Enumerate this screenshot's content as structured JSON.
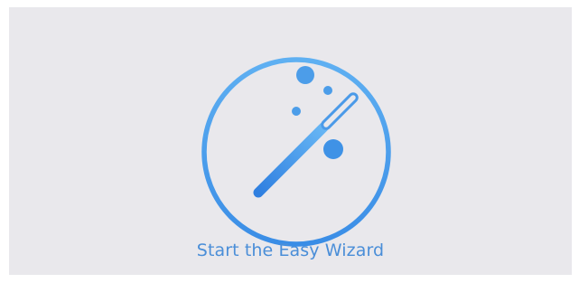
{
  "wizard": {
    "label": "Start the Easy Wizard",
    "icon": "magic-wand-icon",
    "accent_color": "#3a8de6",
    "gradient_light": "#6db8f3",
    "background": "#e9e8ec"
  }
}
